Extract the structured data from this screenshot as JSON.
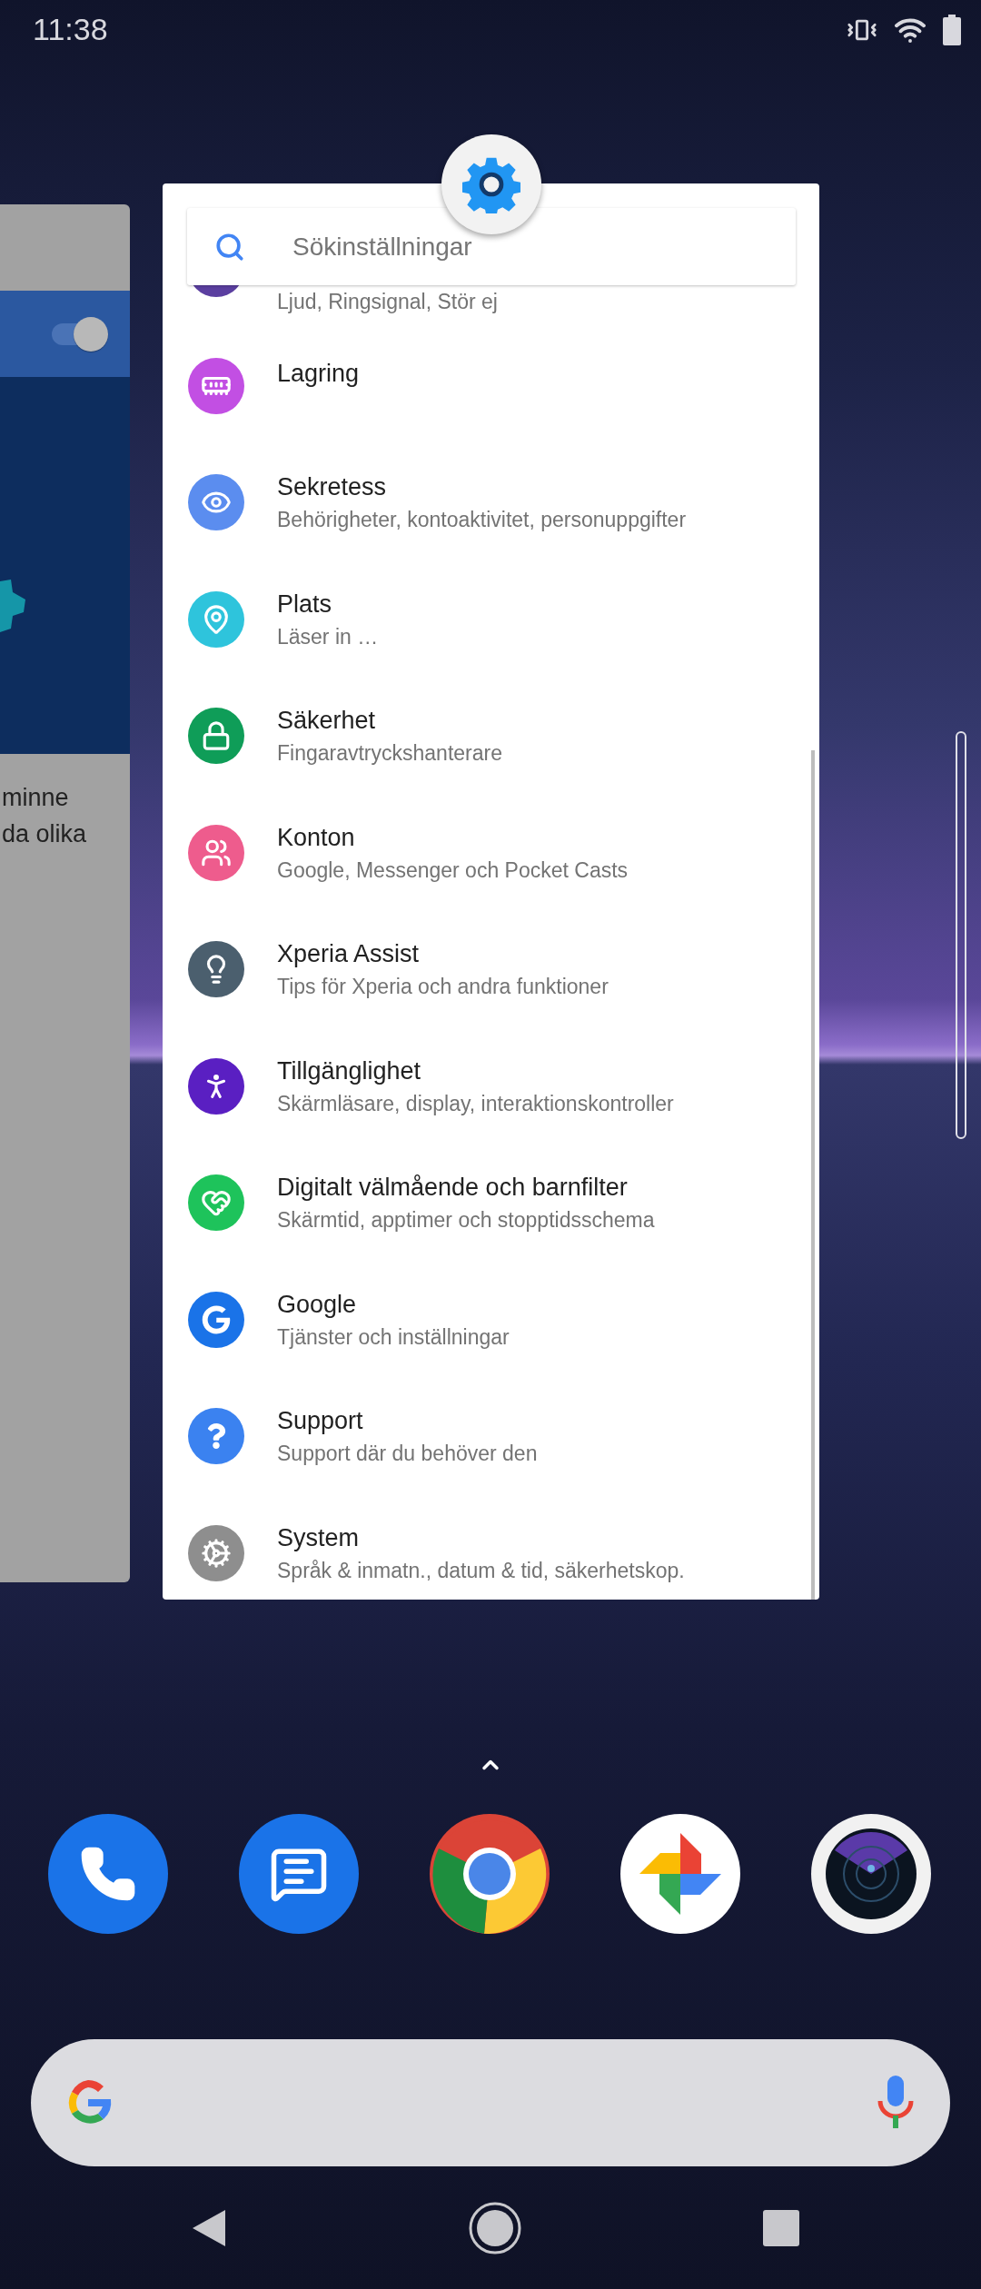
{
  "status_bar": {
    "time": "11:38"
  },
  "recent_apps": {
    "previous_card": {
      "toggle_on": true,
      "text_lines": [
        "minne",
        "da olika"
      ]
    },
    "settings_card": {
      "search": {
        "placeholder": "Sökinställningar"
      },
      "items": [
        {
          "color": "#5b3fa0",
          "subtitle": "Ljud, Ringsignal, Stör ej"
        },
        {
          "kind": "storage",
          "color": "#c24fe3",
          "title": "Lagring"
        },
        {
          "kind": "privacy",
          "color": "#5b8def",
          "title": "Sekretess",
          "subtitle": "Behörigheter, kontoaktivitet, personuppgifter"
        },
        {
          "kind": "location",
          "color": "#2ec4dc",
          "title": "Plats",
          "subtitle": "Läser in …"
        },
        {
          "kind": "security",
          "color": "#0f9d58",
          "title": "Säkerhet",
          "subtitle": "Fingaravtryckshanterare"
        },
        {
          "kind": "accounts",
          "color": "#ee5c8d",
          "title": "Konton",
          "subtitle": "Google, Messenger och Pocket Casts"
        },
        {
          "kind": "tips",
          "color": "#4b5f6e",
          "title": "Xperia Assist",
          "subtitle": "Tips för Xperia och andra funktioner"
        },
        {
          "kind": "accessibility",
          "color": "#5a1fc2",
          "title": "Tillgänglighet",
          "subtitle": "Skärmläsare, display, interaktionskontroller"
        },
        {
          "kind": "wellbeing",
          "color": "#1ec35b",
          "title": "Digitalt välmående och barnfilter",
          "subtitle": "Skärmtid, apptimer och stopptidsschema"
        },
        {
          "kind": "google",
          "color": "#1a73e8",
          "title": "Google",
          "subtitle": "Tjänster och inställningar"
        },
        {
          "kind": "support",
          "color": "#3b82f0",
          "title": "Support",
          "subtitle": "Support där du behöver den"
        },
        {
          "kind": "system",
          "color": "#8e8e8e",
          "title": "System",
          "subtitle": "Språk & inmatn., datum & tid, säkerhetskop."
        }
      ]
    }
  },
  "dock": {
    "apps": [
      {
        "kind": "phone"
      },
      {
        "kind": "messages"
      },
      {
        "kind": "browser"
      },
      {
        "kind": "photos"
      },
      {
        "kind": "camera"
      }
    ]
  }
}
